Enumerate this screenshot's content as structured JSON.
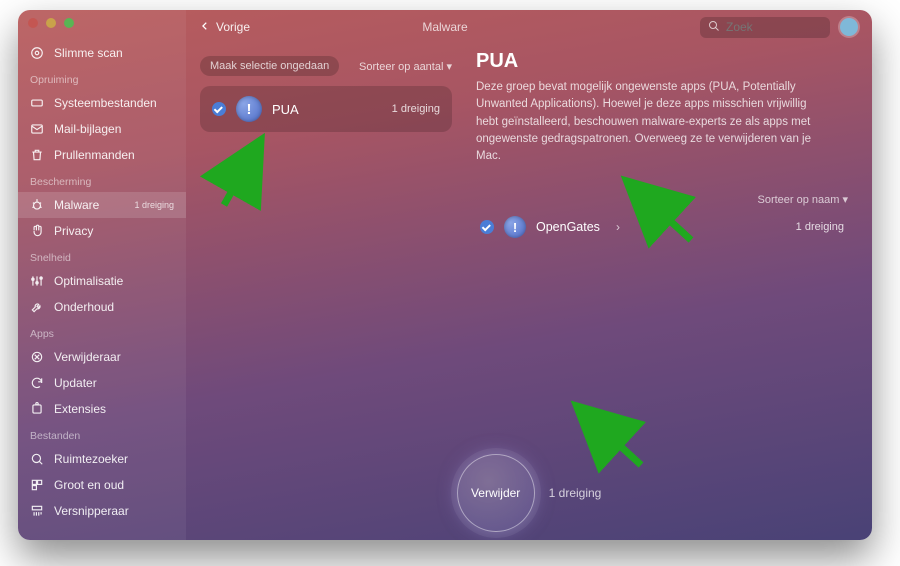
{
  "sidebar": {
    "top_item": {
      "label": "Slimme scan"
    },
    "sections": [
      {
        "heading": "Opruiming",
        "items": [
          {
            "label": "Systeembestanden"
          },
          {
            "label": "Mail-bijlagen"
          },
          {
            "label": "Prullenmanden"
          }
        ]
      },
      {
        "heading": "Bescherming",
        "items": [
          {
            "label": "Malware",
            "badge": "1 dreiging",
            "active": true
          },
          {
            "label": "Privacy"
          }
        ]
      },
      {
        "heading": "Snelheid",
        "items": [
          {
            "label": "Optimalisatie"
          },
          {
            "label": "Onderhoud"
          }
        ]
      },
      {
        "heading": "Apps",
        "items": [
          {
            "label": "Verwijderaar"
          },
          {
            "label": "Updater"
          },
          {
            "label": "Extensies"
          }
        ]
      },
      {
        "heading": "Bestanden",
        "items": [
          {
            "label": "Ruimtezoeker"
          },
          {
            "label": "Groot en oud"
          },
          {
            "label": "Versnipperaar"
          }
        ]
      }
    ]
  },
  "topbar": {
    "back_label": "Vorige",
    "breadcrumb": "Malware",
    "search_placeholder": "Zoek"
  },
  "middle": {
    "deselect_label": "Maak selectie ongedaan",
    "sort_label": "Sorteer op aantal ▾",
    "threat": {
      "name": "PUA",
      "count_label": "1 dreiging"
    }
  },
  "right": {
    "title": "PUA",
    "description": "Deze groep bevat mogelijk ongewenste apps (PUA, Potentially Unwanted Applications). Hoewel je deze apps misschien vrijwillig hebt geïnstalleerd, beschouwen malware-experts ze als apps met ongewenste gedragspatronen. Overweeg ze te verwijderen van je Mac.",
    "sort_label": "Sorteer op naam ▾",
    "item": {
      "name": "OpenGates",
      "count_label": "1 dreiging"
    }
  },
  "action": {
    "button_label": "Verwijder",
    "sub_label": "1 dreiging"
  }
}
